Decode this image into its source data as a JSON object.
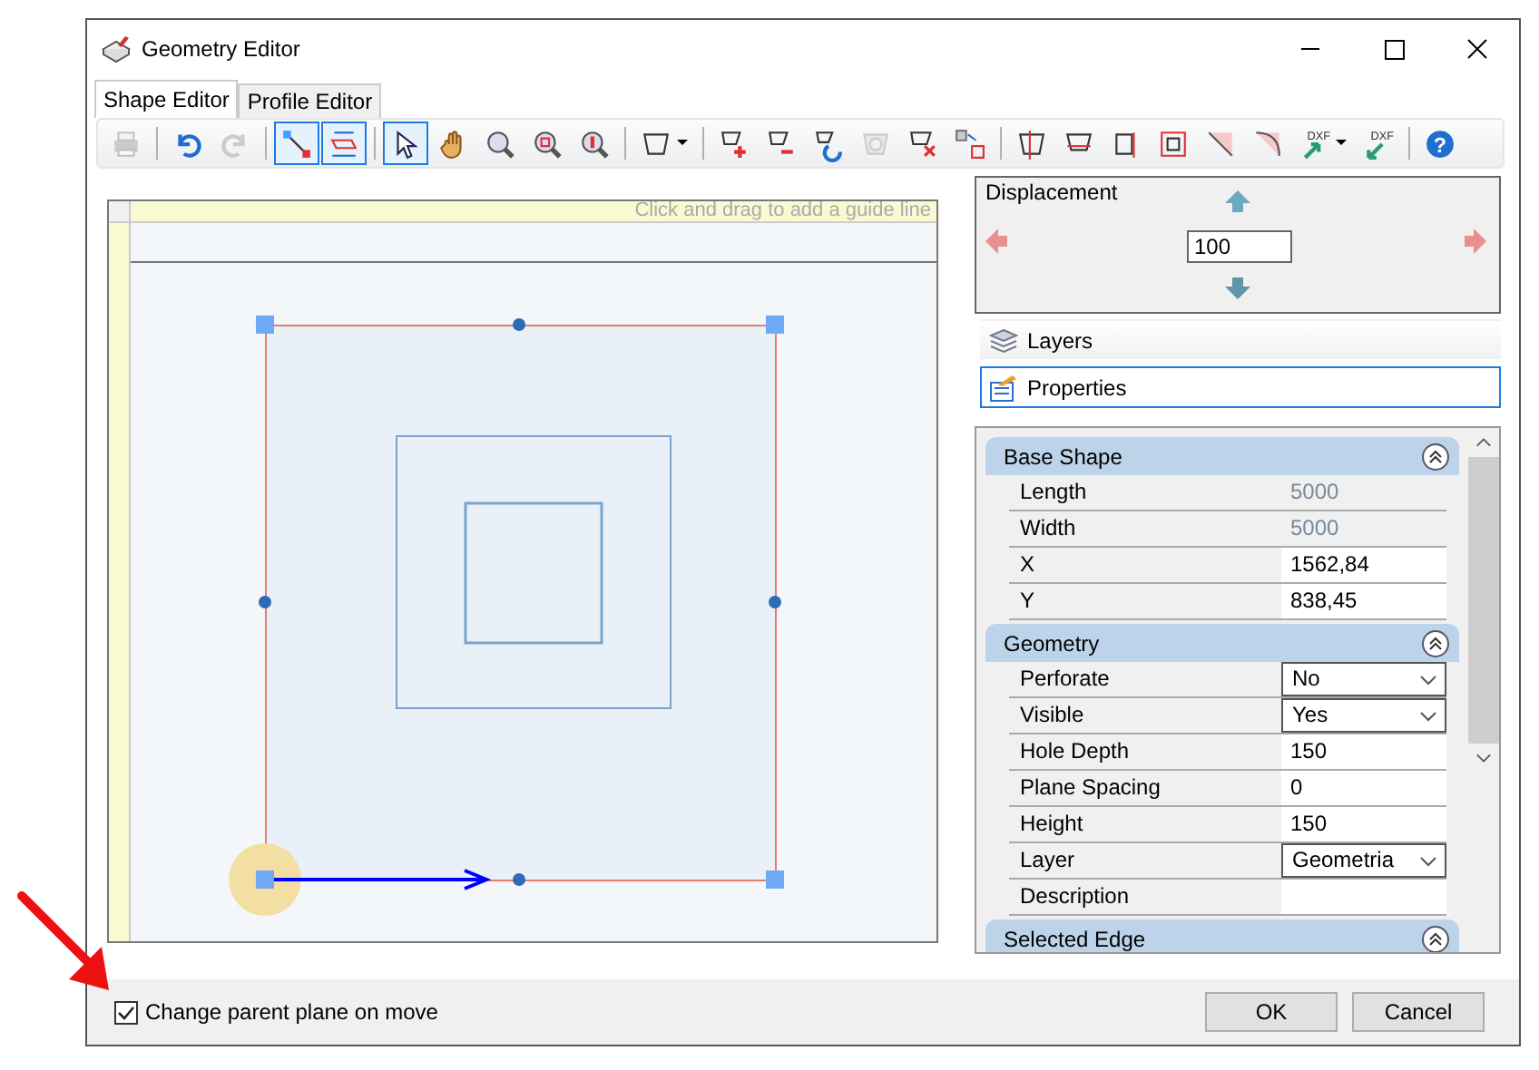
{
  "window": {
    "title": "Geometry Editor"
  },
  "tabs": [
    {
      "label": "Shape Editor",
      "selected": true
    },
    {
      "label": "Profile Editor",
      "selected": false
    }
  ],
  "toolbar": [
    [
      {
        "kind": "print",
        "selected": false,
        "disabled": true,
        "dropdown": false
      }
    ],
    [
      {
        "kind": "undo",
        "selected": false,
        "disabled": false,
        "dropdown": false
      },
      {
        "kind": "redo",
        "selected": false,
        "disabled": true,
        "dropdown": false
      }
    ],
    [
      {
        "kind": "snap-node",
        "selected": true,
        "disabled": false,
        "dropdown": false
      },
      {
        "kind": "snap-edge",
        "selected": true,
        "disabled": false,
        "dropdown": false
      }
    ],
    [
      {
        "kind": "select",
        "selected": true,
        "disabled": false,
        "dropdown": false
      },
      {
        "kind": "pan",
        "selected": false,
        "disabled": false,
        "dropdown": false
      },
      {
        "kind": "zoom",
        "selected": false,
        "disabled": false,
        "dropdown": false
      },
      {
        "kind": "zoom-window",
        "selected": false,
        "disabled": false,
        "dropdown": false
      },
      {
        "kind": "zoom-extent",
        "selected": false,
        "disabled": false,
        "dropdown": false
      }
    ],
    [
      {
        "kind": "shape",
        "selected": false,
        "disabled": false,
        "dropdown": true
      }
    ],
    [
      {
        "kind": "add-node",
        "selected": false,
        "disabled": false,
        "dropdown": false
      },
      {
        "kind": "remove-node",
        "selected": false,
        "disabled": false,
        "dropdown": false
      },
      {
        "kind": "rotate",
        "selected": false,
        "disabled": false,
        "dropdown": false
      },
      {
        "kind": "hide",
        "selected": false,
        "disabled": true,
        "dropdown": false
      },
      {
        "kind": "delete-node",
        "selected": false,
        "disabled": false,
        "dropdown": false
      },
      {
        "kind": "move",
        "selected": false,
        "disabled": false,
        "dropdown": false
      }
    ],
    [
      {
        "kind": "split-edge",
        "selected": false,
        "disabled": false,
        "dropdown": false
      },
      {
        "kind": "edge-cut",
        "selected": false,
        "disabled": false,
        "dropdown": false
      },
      {
        "kind": "vertical-edge",
        "selected": false,
        "disabled": false,
        "dropdown": false
      },
      {
        "kind": "inner-shape",
        "selected": false,
        "disabled": false,
        "dropdown": false
      },
      {
        "kind": "chamfer",
        "selected": false,
        "disabled": false,
        "dropdown": false
      },
      {
        "kind": "fillet",
        "selected": false,
        "disabled": false,
        "dropdown": false
      },
      {
        "kind": "dxf-import",
        "label": "DXF",
        "selected": false,
        "disabled": false,
        "dropdown": true
      },
      {
        "kind": "dxf-export",
        "label": "DXF",
        "selected": false,
        "disabled": false,
        "dropdown": false
      }
    ],
    [
      {
        "kind": "help",
        "label": "?",
        "selected": false,
        "disabled": false,
        "dropdown": false
      }
    ]
  ],
  "canvas": {
    "guide_hint": "Click and drag to add a guide line"
  },
  "displacement": {
    "title": "Displacement",
    "value": "100"
  },
  "panels": [
    {
      "kind": "layers",
      "label": "Layers",
      "selected": false
    },
    {
      "kind": "properties",
      "label": "Properties",
      "selected": true
    }
  ],
  "property_grid": [
    {
      "title": "Base Shape",
      "expanded": true,
      "rows": [
        {
          "label": "Length",
          "value": "5000",
          "kind": "readonly"
        },
        {
          "label": "Width",
          "value": "5000",
          "kind": "readonly"
        },
        {
          "label": "X",
          "value": "1562,84",
          "kind": "text"
        },
        {
          "label": "Y",
          "value": "838,45",
          "kind": "text"
        }
      ]
    },
    {
      "title": "Geometry",
      "expanded": true,
      "rows": [
        {
          "label": "Perforate",
          "value": "No",
          "kind": "dropdown"
        },
        {
          "label": "Visible",
          "value": "Yes",
          "kind": "dropdown"
        },
        {
          "label": "Hole Depth",
          "value": "150",
          "kind": "text"
        },
        {
          "label": "Plane Spacing",
          "value": "0",
          "kind": "text"
        },
        {
          "label": "Height",
          "value": "150",
          "kind": "text"
        },
        {
          "label": "Layer",
          "value": "Geometria",
          "kind": "dropdown"
        },
        {
          "label": "Description",
          "value": "",
          "kind": "text"
        }
      ]
    },
    {
      "title": "Selected Edge",
      "expanded": true
    }
  ],
  "footer": {
    "checkbox": {
      "label": "Change parent plane on move",
      "checked": true
    },
    "buttons": [
      "OK",
      "Cancel"
    ]
  }
}
